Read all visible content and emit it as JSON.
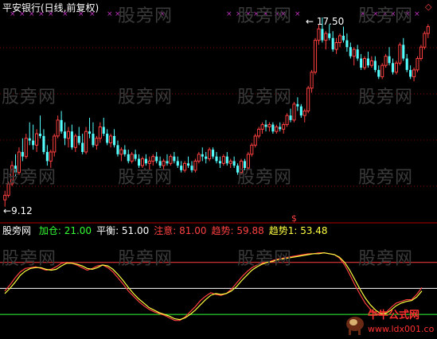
{
  "title": "平安银行(日线,前复权)",
  "watermark_text": "股旁网",
  "chart_data": [
    {
      "type": "candlestick",
      "title": "平安银行(日线,前复权)",
      "annotations": {
        "high": "17.50",
        "low": "9.12"
      },
      "ylim": [
        9.12,
        17.5
      ],
      "colors": {
        "up": "#ff4040",
        "down": "#54ffff"
      },
      "candles": [
        [
          9.5,
          9.9,
          9.2,
          9.7
        ],
        [
          9.7,
          10.3,
          9.6,
          10.2
        ],
        [
          10.2,
          11.2,
          10.1,
          11.0
        ],
        [
          11.0,
          11.5,
          10.5,
          10.7
        ],
        [
          10.7,
          11.8,
          10.6,
          11.6
        ],
        [
          11.6,
          12.2,
          11.2,
          11.4
        ],
        [
          11.4,
          12.4,
          11.3,
          12.2
        ],
        [
          12.2,
          12.9,
          11.9,
          12.1
        ],
        [
          12.1,
          12.8,
          11.7,
          11.9
        ],
        [
          11.9,
          12.6,
          11.6,
          12.4
        ],
        [
          12.4,
          13.2,
          12.2,
          12.3
        ],
        [
          12.3,
          12.6,
          11.5,
          11.6
        ],
        [
          11.6,
          11.9,
          11.0,
          11.2
        ],
        [
          11.2,
          11.7,
          10.9,
          11.6
        ],
        [
          11.6,
          12.4,
          11.4,
          12.3
        ],
        [
          12.3,
          13.2,
          12.2,
          13.0
        ],
        [
          13.0,
          13.4,
          12.4,
          12.5
        ],
        [
          12.5,
          12.9,
          11.9,
          12.2
        ],
        [
          12.2,
          12.7,
          11.8,
          12.5
        ],
        [
          12.5,
          12.8,
          11.7,
          11.8
        ],
        [
          11.8,
          12.4,
          11.6,
          12.3
        ],
        [
          12.3,
          12.7,
          11.9,
          12.0
        ],
        [
          12.0,
          12.4,
          11.5,
          11.6
        ],
        [
          11.6,
          12.7,
          11.5,
          12.5
        ],
        [
          12.5,
          13.1,
          12.2,
          12.4
        ],
        [
          12.4,
          12.9,
          11.8,
          11.9
        ],
        [
          11.9,
          12.3,
          11.7,
          12.2
        ],
        [
          12.2,
          12.9,
          12.0,
          12.7
        ],
        [
          12.7,
          13.1,
          12.3,
          12.4
        ],
        [
          12.4,
          12.6,
          11.9,
          12.0
        ],
        [
          12.0,
          12.4,
          11.8,
          12.3
        ],
        [
          12.3,
          12.6,
          11.8,
          11.9
        ],
        [
          11.9,
          12.1,
          11.4,
          11.5
        ],
        [
          11.5,
          11.8,
          11.2,
          11.7
        ],
        [
          11.7,
          11.9,
          11.4,
          11.5
        ],
        [
          11.5,
          11.7,
          11.1,
          11.2
        ],
        [
          11.2,
          11.6,
          11.1,
          11.5
        ],
        [
          11.5,
          11.7,
          11.2,
          11.3
        ],
        [
          11.3,
          11.5,
          10.9,
          11.0
        ],
        [
          11.0,
          11.4,
          10.9,
          11.3
        ],
        [
          11.3,
          11.5,
          11.0,
          11.1
        ],
        [
          11.1,
          11.4,
          10.8,
          11.2
        ],
        [
          11.2,
          11.5,
          11.0,
          11.4
        ],
        [
          11.4,
          11.6,
          11.1,
          11.2
        ],
        [
          11.2,
          11.4,
          10.9,
          11.0
        ],
        [
          11.0,
          11.3,
          10.8,
          11.2
        ],
        [
          11.2,
          11.5,
          11.0,
          11.1
        ],
        [
          11.1,
          11.5,
          11.0,
          11.4
        ],
        [
          11.4,
          11.6,
          11.1,
          11.2
        ],
        [
          11.2,
          11.4,
          10.9,
          11.0
        ],
        [
          11.0,
          11.2,
          10.7,
          10.8
        ],
        [
          10.8,
          11.2,
          10.7,
          11.1
        ],
        [
          11.1,
          11.4,
          10.9,
          11.0
        ],
        [
          11.0,
          11.2,
          10.7,
          10.8
        ],
        [
          10.8,
          11.3,
          10.7,
          11.2
        ],
        [
          11.2,
          11.6,
          11.1,
          11.5
        ],
        [
          11.5,
          11.8,
          11.2,
          11.4
        ],
        [
          11.4,
          11.6,
          11.1,
          11.3
        ],
        [
          11.3,
          11.8,
          11.2,
          11.7
        ],
        [
          11.7,
          11.8,
          11.3,
          11.4
        ],
        [
          11.4,
          11.6,
          11.1,
          11.2
        ],
        [
          11.2,
          11.4,
          10.9,
          11.1
        ],
        [
          11.1,
          11.5,
          11.0,
          11.4
        ],
        [
          11.4,
          11.6,
          11.0,
          11.1
        ],
        [
          11.1,
          11.3,
          10.9,
          11.2
        ],
        [
          11.2,
          11.4,
          10.9,
          11.0
        ],
        [
          11.0,
          11.1,
          10.6,
          10.7
        ],
        [
          10.7,
          11.3,
          10.6,
          11.2
        ],
        [
          11.2,
          11.3,
          10.8,
          10.9
        ],
        [
          10.9,
          11.6,
          10.8,
          11.5
        ],
        [
          11.5,
          12.0,
          11.4,
          11.9
        ],
        [
          11.9,
          12.4,
          11.8,
          12.3
        ],
        [
          12.3,
          12.7,
          12.2,
          12.6
        ],
        [
          12.6,
          12.9,
          12.4,
          12.8
        ],
        [
          12.8,
          13.0,
          12.5,
          12.7
        ],
        [
          12.7,
          12.9,
          12.5,
          12.8
        ],
        [
          12.8,
          12.9,
          12.4,
          12.5
        ],
        [
          12.5,
          12.8,
          12.4,
          12.7
        ],
        [
          12.7,
          12.9,
          12.5,
          12.6
        ],
        [
          12.6,
          12.9,
          12.4,
          12.8
        ],
        [
          12.8,
          13.3,
          12.7,
          13.2
        ],
        [
          13.2,
          13.5,
          12.9,
          13.0
        ],
        [
          13.0,
          13.8,
          12.9,
          13.7
        ],
        [
          13.7,
          14.0,
          13.4,
          13.6
        ],
        [
          13.6,
          13.7,
          13.1,
          13.2
        ],
        [
          13.2,
          13.5,
          12.9,
          13.4
        ],
        [
          13.4,
          14.5,
          13.3,
          14.4
        ],
        [
          14.4,
          15.2,
          14.2,
          15.1
        ],
        [
          15.1,
          16.6,
          15.0,
          16.5
        ],
        [
          16.5,
          17.2,
          16.3,
          17.0
        ],
        [
          17.0,
          17.5,
          16.4,
          16.5
        ],
        [
          16.5,
          16.9,
          16.1,
          16.8
        ],
        [
          16.8,
          17.2,
          16.5,
          16.6
        ],
        [
          16.6,
          16.9,
          16.0,
          16.1
        ],
        [
          16.1,
          16.6,
          15.9,
          16.4
        ],
        [
          16.4,
          16.8,
          16.2,
          16.7
        ],
        [
          16.7,
          17.1,
          16.4,
          16.5
        ],
        [
          16.5,
          16.8,
          16.0,
          16.2
        ],
        [
          16.2,
          16.4,
          15.7,
          15.8
        ],
        [
          15.8,
          16.2,
          15.4,
          16.1
        ],
        [
          16.1,
          16.3,
          15.6,
          15.7
        ],
        [
          15.7,
          15.9,
          15.2,
          15.3
        ],
        [
          15.3,
          15.8,
          15.2,
          15.7
        ],
        [
          15.7,
          16.0,
          15.3,
          15.4
        ],
        [
          15.4,
          15.8,
          15.3,
          15.6
        ],
        [
          15.6,
          15.8,
          15.1,
          15.2
        ],
        [
          15.2,
          15.4,
          14.8,
          14.9
        ],
        [
          14.9,
          15.5,
          14.8,
          15.4
        ],
        [
          15.4,
          15.9,
          15.3,
          15.8
        ],
        [
          15.8,
          16.2,
          15.4,
          15.5
        ],
        [
          15.5,
          15.7,
          15.0,
          15.1
        ],
        [
          15.1,
          15.6,
          15.0,
          15.5
        ],
        [
          15.5,
          16.4,
          15.4,
          16.3
        ],
        [
          16.3,
          16.6,
          15.6,
          15.7
        ],
        [
          15.7,
          15.9,
          15.1,
          15.2
        ],
        [
          15.2,
          15.4,
          14.8,
          14.9
        ],
        [
          14.9,
          15.3,
          14.7,
          15.2
        ],
        [
          15.2,
          15.8,
          15.1,
          15.7
        ],
        [
          15.7,
          16.3,
          15.6,
          16.2
        ],
        [
          16.2,
          16.9,
          16.1,
          16.8
        ],
        [
          16.8,
          17.2,
          16.6,
          17.1
        ]
      ]
    },
    {
      "type": "line",
      "title": "股旁网",
      "legend": [
        {
          "name": "加仓",
          "value": "21.00",
          "color": "#33ff33"
        },
        {
          "name": "平衡",
          "value": "51.00",
          "color": "#ffffff"
        },
        {
          "name": "注意",
          "value": "81.00",
          "color": "#ff4040"
        },
        {
          "name": "趋势",
          "value": "59.88",
          "color": "#ff4040"
        },
        {
          "name": "趋势1",
          "value": "53.48",
          "color": "#ffff40"
        }
      ],
      "signal_label": "$",
      "ylim": [
        0,
        100
      ],
      "hlines": [
        {
          "name": "注意",
          "value": 81,
          "color": "#ff4040"
        },
        {
          "name": "平衡",
          "value": 51,
          "color": "#ffffff"
        },
        {
          "name": "加仓",
          "value": 21,
          "color": "#33ff33"
        }
      ],
      "series": [
        {
          "name": "趋势",
          "color": "#ff4040",
          "values": [
            48,
            55,
            63,
            70,
            74,
            75,
            76,
            74,
            72,
            73,
            76,
            80,
            81,
            80,
            78,
            75,
            72,
            74,
            77,
            78,
            75,
            70,
            63,
            56,
            48,
            42,
            36,
            31,
            27,
            24,
            22,
            20,
            17,
            14,
            14,
            18,
            24,
            30,
            37,
            42,
            46,
            44,
            43,
            45,
            50,
            57,
            64,
            70,
            75,
            78,
            80,
            81,
            83,
            85,
            86,
            87,
            88,
            89,
            90,
            91,
            91,
            92,
            92,
            91,
            90,
            86,
            78,
            67,
            55,
            44,
            34,
            27,
            22,
            21,
            23,
            29,
            34,
            36,
            38,
            38,
            44,
            52
          ]
        },
        {
          "name": "趋势1",
          "color": "#ffff40",
          "values": [
            45,
            51,
            58,
            66,
            71,
            74,
            75,
            75,
            73,
            72,
            73,
            77,
            80,
            80,
            79,
            77,
            74,
            73,
            75,
            78,
            77,
            73,
            67,
            60,
            52,
            45,
            39,
            34,
            29,
            26,
            23,
            21,
            19,
            16,
            15,
            17,
            21,
            26,
            32,
            38,
            43,
            45,
            44,
            45,
            48,
            53,
            60,
            66,
            72,
            76,
            79,
            81,
            82,
            84,
            85,
            86,
            87,
            88,
            89,
            90,
            91,
            91,
            92,
            91,
            90,
            87,
            81,
            72,
            61,
            50,
            40,
            32,
            26,
            22,
            22,
            26,
            31,
            34,
            36,
            37,
            41,
            48
          ]
        }
      ]
    }
  ]
}
